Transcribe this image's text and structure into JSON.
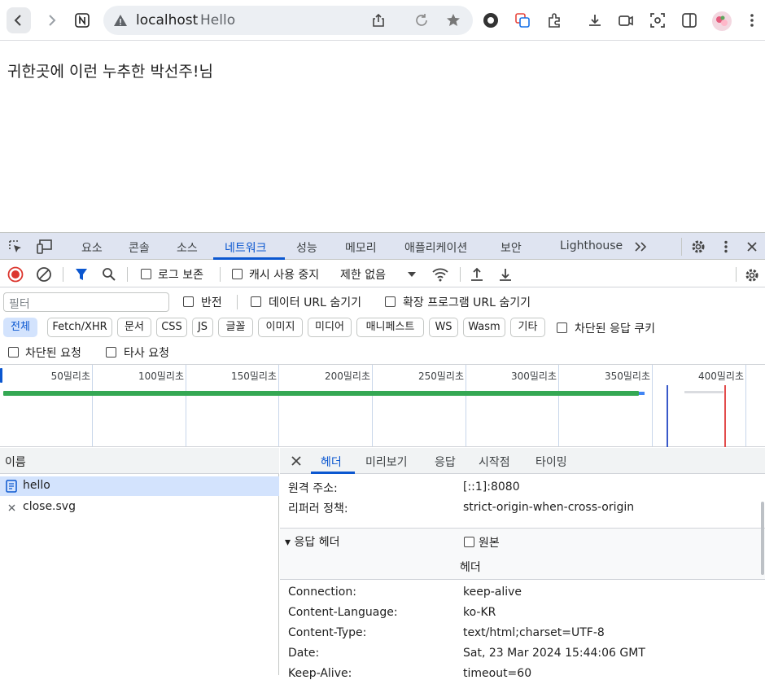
{
  "browser": {
    "url_host": "localhost",
    "page_title": "Hello",
    "icons": [
      "back-icon",
      "forward-icon",
      "notion-icon",
      "lock-warning-icon",
      "share-icon",
      "reload-icon",
      "bookmark-star-icon",
      "github-icon",
      "tabs-icon",
      "extensions-icon",
      "download-icon",
      "cast-icon",
      "screenshot-icon",
      "sidepanel-icon",
      "avatar",
      "menu-icon"
    ]
  },
  "page": {
    "greeting": "귀한곳에 이런 누추한 박선주!님"
  },
  "devtools": {
    "tabs": [
      "요소",
      "콘솔",
      "소스",
      "네트워크",
      "성능",
      "메모리",
      "애플리케이션",
      "보안",
      "Lighthouse"
    ],
    "active_tab": "네트워크",
    "toolbar": {
      "preserve_log": "로그 보존",
      "disable_cache": "캐시 사용 중지",
      "throttle": "제한 없음"
    },
    "filter": {
      "placeholder": "필터",
      "invert": "반전",
      "hide_data_url": "데이터 URL 숨기기",
      "hide_ext_url": "확장 프로그램 URL 숨기기"
    },
    "types": [
      "전체",
      "Fetch/XHR",
      "문서",
      "CSS",
      "JS",
      "글꼴",
      "이미지",
      "미디어",
      "매니페스트",
      "WS",
      "Wasm",
      "기타"
    ],
    "active_type": "전체",
    "blocked_cookies": "차단된 응답 쿠키",
    "blocked_requests": "차단된 요청",
    "third_party": "타사 요청",
    "timeline_ticks": [
      "50밀리초",
      "100밀리초",
      "150밀리초",
      "200밀리초",
      "250밀리초",
      "300밀리초",
      "350밀리초",
      "400밀리초"
    ],
    "requests_header": "이름",
    "requests": [
      {
        "name": "hello",
        "type": "document"
      },
      {
        "name": "close.svg",
        "type": "failed"
      }
    ],
    "detail_tabs": [
      "헤더",
      "미리보기",
      "응답",
      "시작점",
      "타이밍"
    ],
    "active_detail_tab": "헤더",
    "general": [
      {
        "k": "원격 주소:",
        "v": "[::1]:8080"
      },
      {
        "k": "리퍼러 정책:",
        "v": "strict-origin-when-cross-origin"
      }
    ],
    "response_section": "▾ 응답 헤더",
    "raw_label": "원본",
    "header_label": "헤더",
    "response_headers": [
      {
        "k": "Connection:",
        "v": "keep-alive"
      },
      {
        "k": "Content-Language:",
        "v": "ko-KR"
      },
      {
        "k": "Content-Type:",
        "v": "text/html;charset=UTF-8"
      },
      {
        "k": "Date:",
        "v": "Sat, 23 Mar 2024 15:44:06 GMT"
      },
      {
        "k": "Keep-Alive:",
        "v": "timeout=60"
      }
    ]
  },
  "colors": {
    "accent": "#0b57d0",
    "active_tab_bg": "#d3e3fd",
    "record_red": "#dc362e",
    "waterfall_green": "#34a853"
  }
}
